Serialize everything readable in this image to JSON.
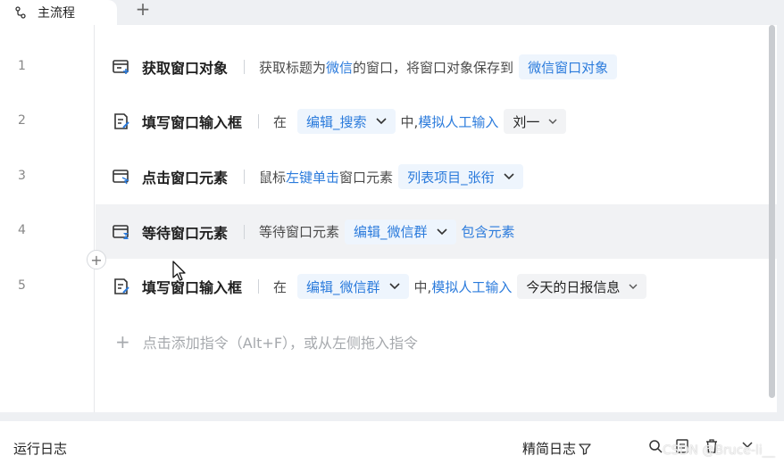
{
  "tabs": {
    "active_label": "主流程",
    "add_symbol": "+"
  },
  "rows": [
    {
      "num": "1",
      "title": "获取窗口对象",
      "t1": "获取标题为",
      "link1": "微信",
      "t2": "的窗口，将窗口对象保存到",
      "chip1": "微信窗口对象"
    },
    {
      "num": "2",
      "title": "填写窗口输入框",
      "t1": "在",
      "chip1": "编辑_搜索",
      "t2": "中,",
      "link1": "模拟人工输入",
      "chip2": "刘一"
    },
    {
      "num": "3",
      "title": "点击窗口元素",
      "t1": "鼠标",
      "link1": "左键单击",
      "t2": "窗口元素",
      "chip1": "列表项目_张衔"
    },
    {
      "num": "4",
      "title": "等待窗口元素",
      "t1": "等待窗口元素",
      "chip1": "编辑_微信群",
      "link1": "包含元素"
    },
    {
      "num": "5",
      "title": "填写窗口输入框",
      "t1": "在",
      "chip1": "编辑_微信群",
      "t2": "中,",
      "link1": "模拟人工输入",
      "chip2": "今天的日报信息"
    }
  ],
  "add_hint": "点击添加指令（Alt+F），或从左侧拖入指令",
  "insert_symbol": "+",
  "log": {
    "title": "运行日志",
    "simple_log": "精简日志"
  },
  "watermark": "CSDN @Bruce-li__",
  "colors": {
    "accent": "#2b7bdc",
    "chip_bg": "#eef5fd",
    "hover_row": "#f1f2f4"
  }
}
